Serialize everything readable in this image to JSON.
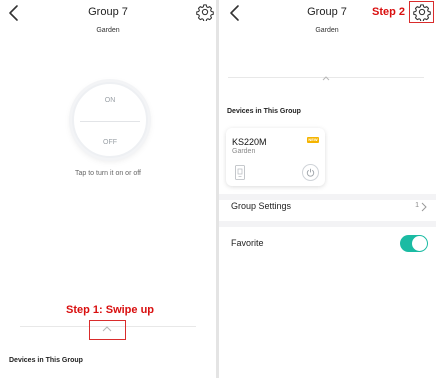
{
  "left_screen": {
    "title": "Group 7",
    "subtitle": "Garden",
    "power_knob": {
      "on_label": "ON",
      "off_label": "OFF"
    },
    "hint": "Tap to turn it on or off",
    "step_label": "Step 1: Swipe up",
    "devices_section_label": "Devices in This Group"
  },
  "right_screen": {
    "title": "Group 7",
    "subtitle": "Garden",
    "step_label": "Step 2",
    "devices_section_label": "Devices in This Group",
    "device": {
      "name": "KS220M",
      "room": "Garden",
      "badge": "NEW"
    },
    "group_settings": {
      "label": "Group Settings",
      "count": "1"
    },
    "favorite": {
      "label": "Favorite",
      "enabled": true
    }
  },
  "colors": {
    "step_annotation": "#d90f0f",
    "toggle_on": "#1bbba3",
    "badge": "#f5b400"
  },
  "icons": [
    "back-icon",
    "gear-icon",
    "chevron-up-icon",
    "plug-icon",
    "power-icon",
    "chevron-right-icon"
  ]
}
